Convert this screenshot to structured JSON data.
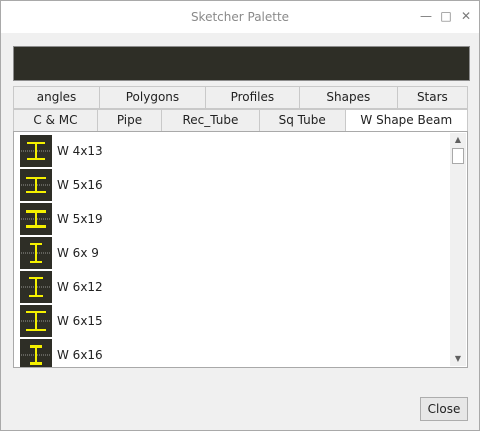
{
  "window": {
    "title": "Sketcher Palette",
    "minimize_glyph": "—",
    "maximize_glyph": "□",
    "close_glyph": "✕"
  },
  "tabs_row1": [
    {
      "label": "angles"
    },
    {
      "label": "Polygons"
    },
    {
      "label": "Profiles"
    },
    {
      "label": "Shapes"
    },
    {
      "label": "Stars"
    }
  ],
  "tabs_row2": [
    {
      "label": "C & MC"
    },
    {
      "label": "Pipe"
    },
    {
      "label": "Rec_Tube"
    },
    {
      "label": "Sq Tube"
    },
    {
      "label": "W Shape Beam",
      "active": true
    }
  ],
  "list": {
    "items": [
      {
        "label": "W 4x13"
      },
      {
        "label": "W 5x16"
      },
      {
        "label": "W 5x19"
      },
      {
        "label": "W 6x 9"
      },
      {
        "label": "W 6x12"
      },
      {
        "label": "W 6x15"
      },
      {
        "label": "W 6x16"
      }
    ]
  },
  "scrollbar": {
    "up_glyph": "▲",
    "down_glyph": "▼"
  },
  "footer": {
    "close_label": "Close"
  },
  "colors": {
    "thumb_background": "#2e2e26",
    "beam_yellow": "#f4f000"
  }
}
